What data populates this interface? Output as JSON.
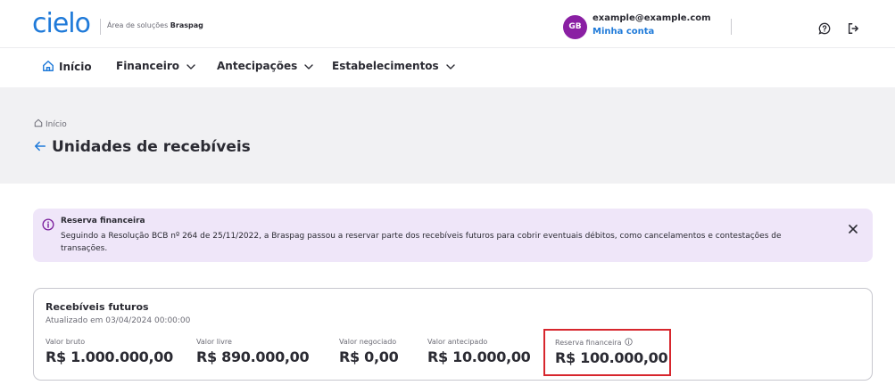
{
  "header": {
    "logo": "cielo",
    "subtitle_prefix": "Área de soluções",
    "subtitle_brand": "Braspag",
    "avatar_initials": "GB",
    "user_email": "example@example.com",
    "account_link": "Minha conta"
  },
  "nav": {
    "items": [
      {
        "label": "Início"
      },
      {
        "label": "Financeiro"
      },
      {
        "label": "Antecipações"
      },
      {
        "label": "Estabelecimentos"
      }
    ]
  },
  "page": {
    "breadcrumb": "Início",
    "title": "Unidades de recebíveis"
  },
  "alert": {
    "title": "Reserva financeira",
    "text": "Seguindo a Resolução BCB nº 264 de 25/11/2022, a Braspag passou a reservar parte dos recebíveis futuros para cobrir eventuais débitos, como cancelamentos e contestações de transações."
  },
  "card": {
    "title": "Recebíveis futuros",
    "updated": "Atualizado em 03/04/2024 00:00:00",
    "metrics": [
      {
        "label": "Valor bruto",
        "value": "R$ 1.000.000,00"
      },
      {
        "label": "Valor livre",
        "value": "R$ 890.000,00"
      },
      {
        "label": "Valor negociado",
        "value": "R$ 0,00"
      },
      {
        "label": "Valor antecipado",
        "value": "R$ 10.000,00"
      },
      {
        "label": "Reserva financeira",
        "value": "R$ 100.000,00"
      }
    ]
  },
  "colors": {
    "brand_blue": "#1f7ad9",
    "avatar_purple": "#8a1fa3",
    "alert_bg": "#efe6f9",
    "highlight_red": "#d7262d"
  }
}
